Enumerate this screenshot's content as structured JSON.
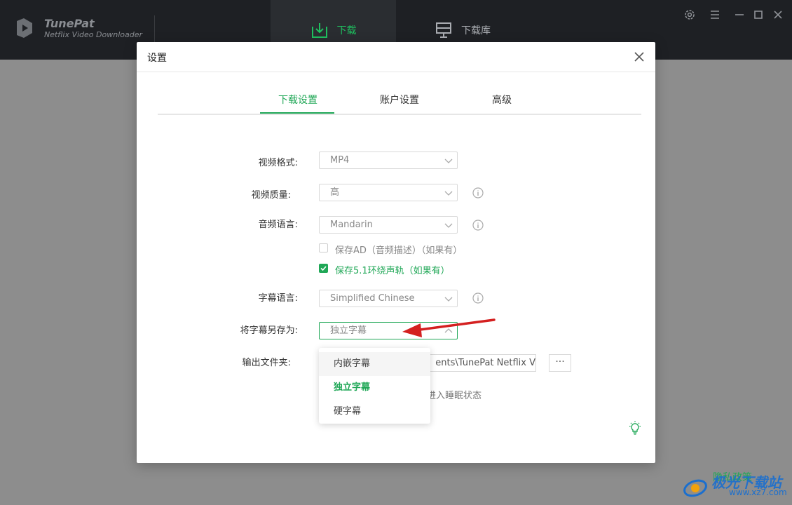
{
  "app": {
    "name": "TunePat",
    "subtitle": "Netflix Video Downloader"
  },
  "nav": {
    "download": "下载",
    "library": "下载库"
  },
  "dialog": {
    "title": "设置",
    "tabs": [
      "下载设置",
      "账户设置",
      "高级"
    ]
  },
  "settings": {
    "video_format_label": "视频格式:",
    "video_format_value": "MP4",
    "video_quality_label": "视频质量:",
    "video_quality_value": "高",
    "audio_lang_label": "音频语言:",
    "audio_lang_value": "Mandarin",
    "save_ad_label": "保存AD（音频描述）（如果有）",
    "save_51_label": "保存5.1环绕声轨（如果有）",
    "subtitle_lang_label": "字幕语言:",
    "subtitle_lang_value": "Simplified Chinese",
    "subtitle_save_label": "将字幕另存为:",
    "subtitle_save_value": "独立字幕",
    "output_folder_label": "输出文件夹:",
    "output_folder_value": "ents\\TunePat Netflix V",
    "output_browse": "···",
    "sleep_text": "进入睡眠状态"
  },
  "dropdown": {
    "options": [
      "内嵌字幕",
      "独立字幕",
      "硬字幕"
    ],
    "selected": "独立字幕"
  },
  "watermark": {
    "privacy": "隐私政策",
    "site": "极光下载站",
    "url": "www.xz7.com"
  },
  "colors": {
    "accent": "#1fa756",
    "titlebar": "#1e2024",
    "annotation": "#d42020"
  }
}
